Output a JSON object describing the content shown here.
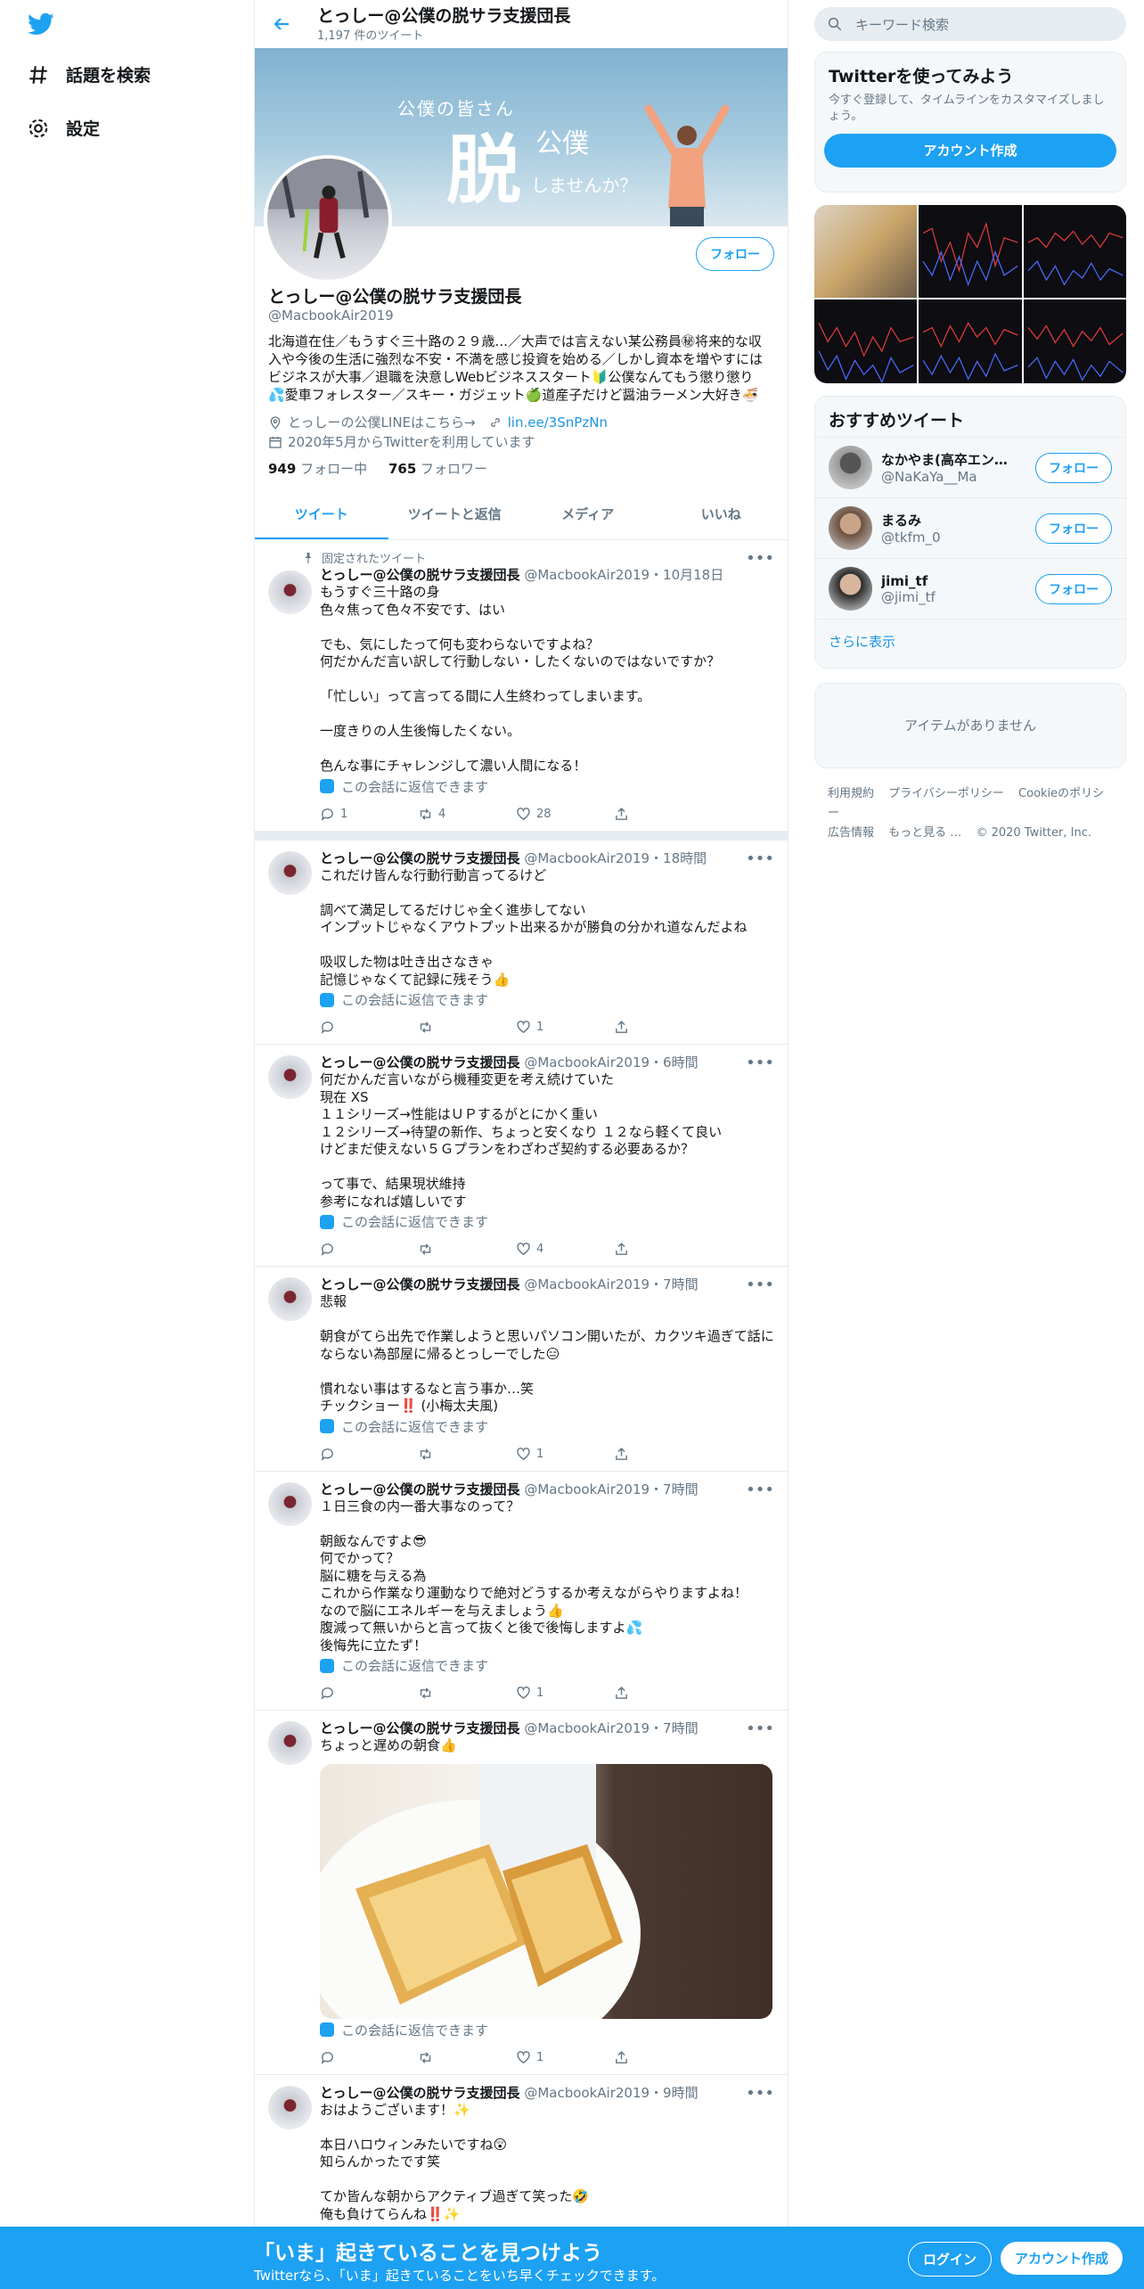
{
  "nav": {
    "explore": "話題を検索",
    "settings": "設定"
  },
  "header": {
    "title": "とっしー@公僕の脱サラ支援団長",
    "tweet_count": "1,197 件のツイート"
  },
  "banner": {
    "line1": "公僕の皆さん",
    "big": "脱",
    "small": "公僕",
    "line3": "しませんか？"
  },
  "profile": {
    "follow": "フォロー",
    "name": "とっしー@公僕の脱サラ支援団長",
    "handle": "@MacbookAir2019",
    "bio": "北海道在住／もうすぐ三十路の２９歳...／大声では言えない某公務員㊙将来的な収入や今後の生活に強烈な不安・不満を感じ投資を始める／しかし資本を増やすにはビジネスが大事／退職を決意しWebビジネススタート🔰公僕なんてもう懲り懲り💦愛車フォレスター／スキー・ガジェット🍏道産子だけど醤油ラーメン大好き🍜",
    "link_label": "とっしーの公僕LINEはこちら→",
    "link_url": "lin.ee/3SnPzNn",
    "joined": "2020年5月からTwitterを利用しています",
    "following_num": "949",
    "following_label": "フォロー中",
    "followers_num": "765",
    "followers_label": "フォロワー"
  },
  "tabs": [
    "ツイート",
    "ツイートと返信",
    "メディア",
    "いいね"
  ],
  "tweets": [
    {
      "pinned": "固定されたツイート",
      "name": "とっしー@公僕の脱サラ支援団長",
      "meta": "@MacbookAir2019・10月18日",
      "body": "もうすぐ三十路の身\n色々焦って色々不安です、はい\n\nでも、気にしたって何も変わらないですよね？\n何だかんだ言い訳して行動しない・したくないのではないですか？\n\n「忙しい」って言ってる間に人生終わってしまいます。\n\n一度きりの人生後悔したくない。\n\n色んな事にチャレンジして濃い人間になる！",
      "conv": "この会話に返信できます",
      "replies": "1",
      "rts": "4",
      "likes": "28"
    },
    {
      "name": "とっしー@公僕の脱サラ支援団長",
      "meta": "@MacbookAir2019・18時間",
      "body": "これだけ皆んな行動行動言ってるけど\n\n調べて満足してるだけじゃ全く進歩してない\nインプットじゃなくアウトプット出来るかが勝負の分かれ道なんだよね\n\n吸収した物は吐き出さなきゃ\n記憶じゃなくて記録に残そう👍",
      "conv": "この会話に返信できます",
      "replies": "",
      "rts": "",
      "likes": "1"
    },
    {
      "name": "とっしー@公僕の脱サラ支援団長",
      "meta": "@MacbookAir2019・6時間",
      "body": "何だかんだ言いながら機種変更を考え続けていた\n現在 XS\n１１シリーズ→性能はＵＰするがとにかく重い\n１２シリーズ→待望の新作、ちょっと安くなり １２なら軽くて良い\nけどまだ使えない５Ｇプランをわざわざ契約する必要あるか？\n\nって事で、結果現状維持\n参考になれば嬉しいです",
      "conv": "この会話に返信できます",
      "replies": "",
      "rts": "",
      "likes": "4"
    },
    {
      "name": "とっしー@公僕の脱サラ支援団長",
      "meta": "@MacbookAir2019・7時間",
      "body": "悲報\n\n朝食がてら出先で作業しようと思いパソコン開いたが、カクツキ過ぎて話にならない為部屋に帰るとっしーでした😑\n\n慣れない事はするなと言う事か…笑\nチックショー‼️ (小梅太夫風)",
      "conv": "この会話に返信できます",
      "replies": "",
      "rts": "",
      "likes": "1"
    },
    {
      "name": "とっしー@公僕の脱サラ支援団長",
      "meta": "@MacbookAir2019・7時間",
      "body": "１日三食の内一番大事なのって？\n\n朝飯なんですよ😎\n何でかって？\n脳に糖を与える為\nこれから作業なり運動なりで絶対どうするか考えながらやりますよね！\nなので脳にエネルギーを与えましょう👍\n腹減って無いからと言って抜くと後で後悔しますよ💦\n後悔先に立たず！",
      "conv": "この会話に返信できます",
      "replies": "",
      "rts": "",
      "likes": "1"
    },
    {
      "name": "とっしー@公僕の脱サラ支援団長",
      "meta": "@MacbookAir2019・7時間",
      "body": "ちょっと遅めの朝食👍",
      "conv": "この会話に返信できます",
      "replies": "",
      "rts": "",
      "likes": "1"
    },
    {
      "name": "とっしー@公僕の脱サラ支援団長",
      "meta": "@MacbookAir2019・9時間",
      "body": "おはようございます！✨\n\n本日ハロウィンみたいですね😲\n知らんかったです笑\n\nてか皆んな朝からアクティブ過ぎて笑った🤣\n俺も負けてらんね‼️✨",
      "conv": "",
      "replies": "",
      "rts": "",
      "likes": ""
    }
  ],
  "right": {
    "search_placeholder": "キーワード検索",
    "signup_title": "Twitterを使ってみよう",
    "signup_desc": "今すぐ登録して、タイムラインをカスタマイズしましょう。",
    "signup_btn": "アカウント作成",
    "rec_title": "おすすめツイート",
    "recs": [
      {
        "name": "なかやま(高卒エンジニア)",
        "handle": "@NaKaYa__Ma",
        "btn": "フォロー"
      },
      {
        "name": "まるみ",
        "handle": "@tkfm_0",
        "btn": "フォロー"
      },
      {
        "name": "jimi_tf",
        "handle": "@jimi_tf",
        "btn": "フォロー"
      }
    ],
    "show_more": "さらに表示",
    "empty": "アイテムがありません",
    "footer": [
      "利用規約",
      "プライバシーポリシー",
      "Cookieのポリシー",
      "広告情報",
      "もっと見る …",
      "© 2020 Twitter, Inc."
    ]
  },
  "bottom": {
    "headline": "「いま」起きていることを見つけよう",
    "sub": "Twitterなら、「いま」起きていることをいち早くチェックできます。",
    "login": "ログイン",
    "signup": "アカウント作成"
  },
  "colors": {
    "accent": "#1da1f2",
    "muted": "#657786",
    "border": "#e6ecf0"
  }
}
